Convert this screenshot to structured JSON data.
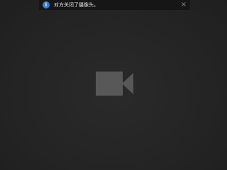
{
  "notice": {
    "info_icon": "i",
    "text": "对方关闭了摄像头。",
    "close_icon": "×"
  },
  "camera_icon": {
    "name": "video-camera-off-icon",
    "color": "#585858"
  },
  "colors": {
    "background": "#242424",
    "notice_bar": "#161616",
    "info_accent": "#2f7fd8"
  }
}
